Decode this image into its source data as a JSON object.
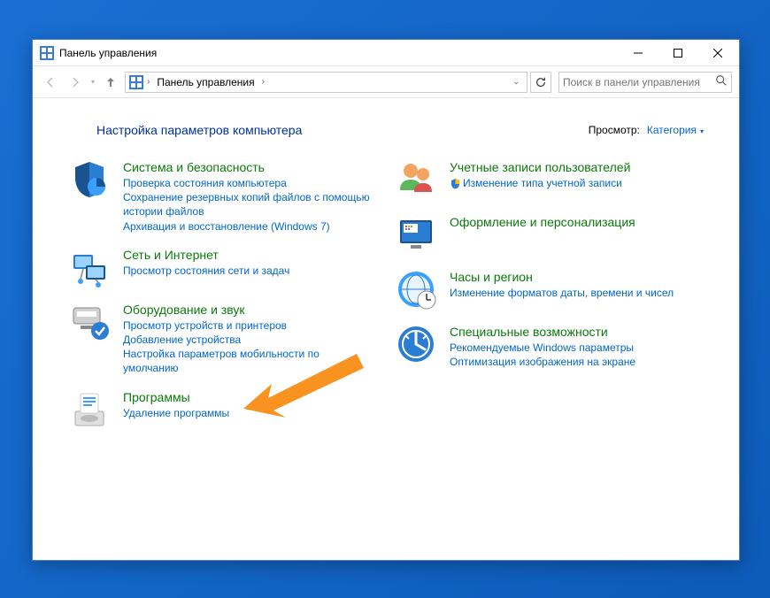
{
  "window": {
    "title": "Панель управления"
  },
  "breadcrumb": {
    "root": "Панель управления"
  },
  "search": {
    "placeholder": "Поиск в панели управления"
  },
  "header": {
    "title": "Настройка параметров компьютера",
    "view_label": "Просмотр:",
    "view_value": "Категория"
  },
  "left": [
    {
      "title": "Система и безопасность",
      "links": [
        {
          "text": "Проверка состояния компьютера"
        },
        {
          "text": "Сохранение резервных копий файлов с помощью истории файлов"
        },
        {
          "text": "Архивация и восстановление (Windows 7)"
        }
      ]
    },
    {
      "title": "Сеть и Интернет",
      "links": [
        {
          "text": "Просмотр состояния сети и задач"
        }
      ]
    },
    {
      "title": "Оборудование и звук",
      "links": [
        {
          "text": "Просмотр устройств и принтеров"
        },
        {
          "text": "Добавление устройства"
        },
        {
          "text": "Настройка параметров мобильности по умолчанию"
        }
      ]
    },
    {
      "title": "Программы",
      "links": [
        {
          "text": "Удаление программы"
        }
      ]
    }
  ],
  "right": [
    {
      "title": "Учетные записи пользователей",
      "links": [
        {
          "text": "Изменение типа учетной записи",
          "shield": true
        }
      ]
    },
    {
      "title": "Оформление и персонализация",
      "links": []
    },
    {
      "title": "Часы и регион",
      "links": [
        {
          "text": "Изменение форматов даты, времени и чисел"
        }
      ]
    },
    {
      "title": "Специальные возможности",
      "links": [
        {
          "text": "Рекомендуемые Windows параметры"
        },
        {
          "text": "Оптимизация изображения на экране"
        }
      ]
    }
  ]
}
